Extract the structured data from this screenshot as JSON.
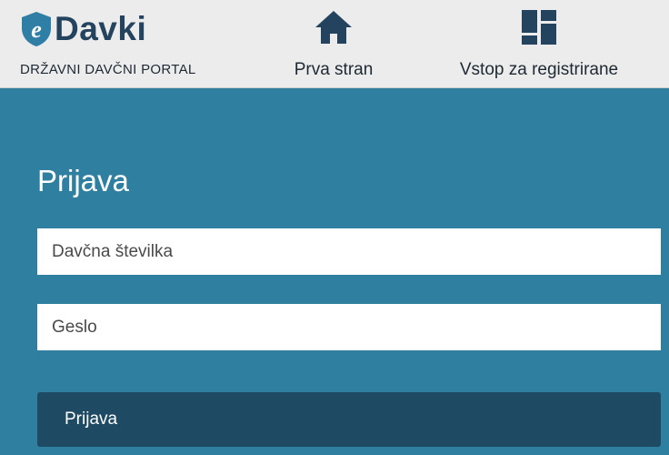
{
  "header": {
    "brand": {
      "logo_letter": "e",
      "name": "Davki",
      "subtitle": "DRŽAVNI DAVČNI PORTAL",
      "icon": "shield-e-logo"
    },
    "nav": [
      {
        "label": "Prva stran",
        "icon": "home-icon"
      },
      {
        "label": "Vstop za registrirane",
        "icon": "dashboard-icon"
      }
    ]
  },
  "login": {
    "title": "Prijava",
    "tax_number_placeholder": "Davčna številka",
    "password_placeholder": "Geslo",
    "submit_label": "Prijava"
  },
  "colors": {
    "page_background": "#2e7fa0",
    "header_background": "#ececec",
    "brand_dark": "#24435e",
    "logo_accent": "#2f7ea6",
    "button_background": "#1e4a63"
  }
}
